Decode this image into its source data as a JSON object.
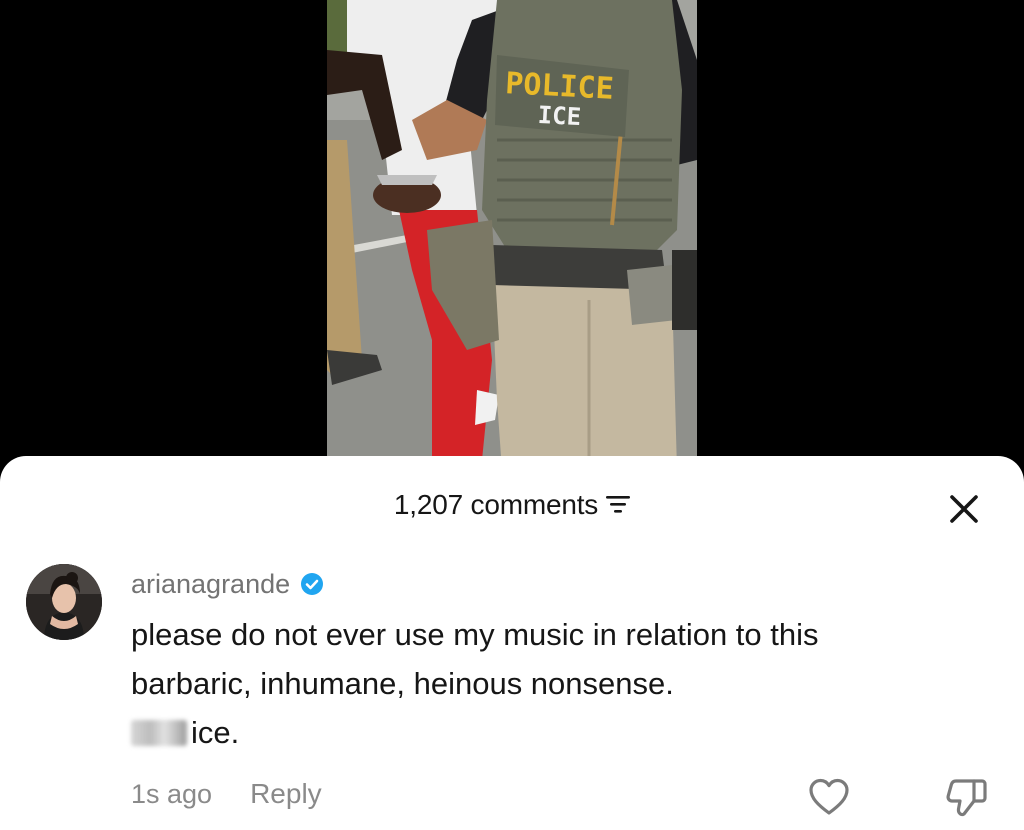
{
  "video": {
    "vest_patch_line1": "POLICE",
    "vest_patch_line2": "ICE"
  },
  "comments_panel": {
    "count_label": "1,207 comments",
    "sort_icon": "sort-filter-icon",
    "close_icon": "close-icon"
  },
  "comment": {
    "username": "arianagrande",
    "verified_icon": "verified-badge-icon",
    "verified_color": "#20a5f0",
    "text_line1": "please do not ever use my music in relation to this",
    "text_line2": "barbaric, inhumane, heinous nonsense.",
    "text_line3": "ice.",
    "time": "1s ago",
    "reply_label": "Reply",
    "like_icon": "heart-icon",
    "dislike_icon": "thumbs-down-icon"
  }
}
